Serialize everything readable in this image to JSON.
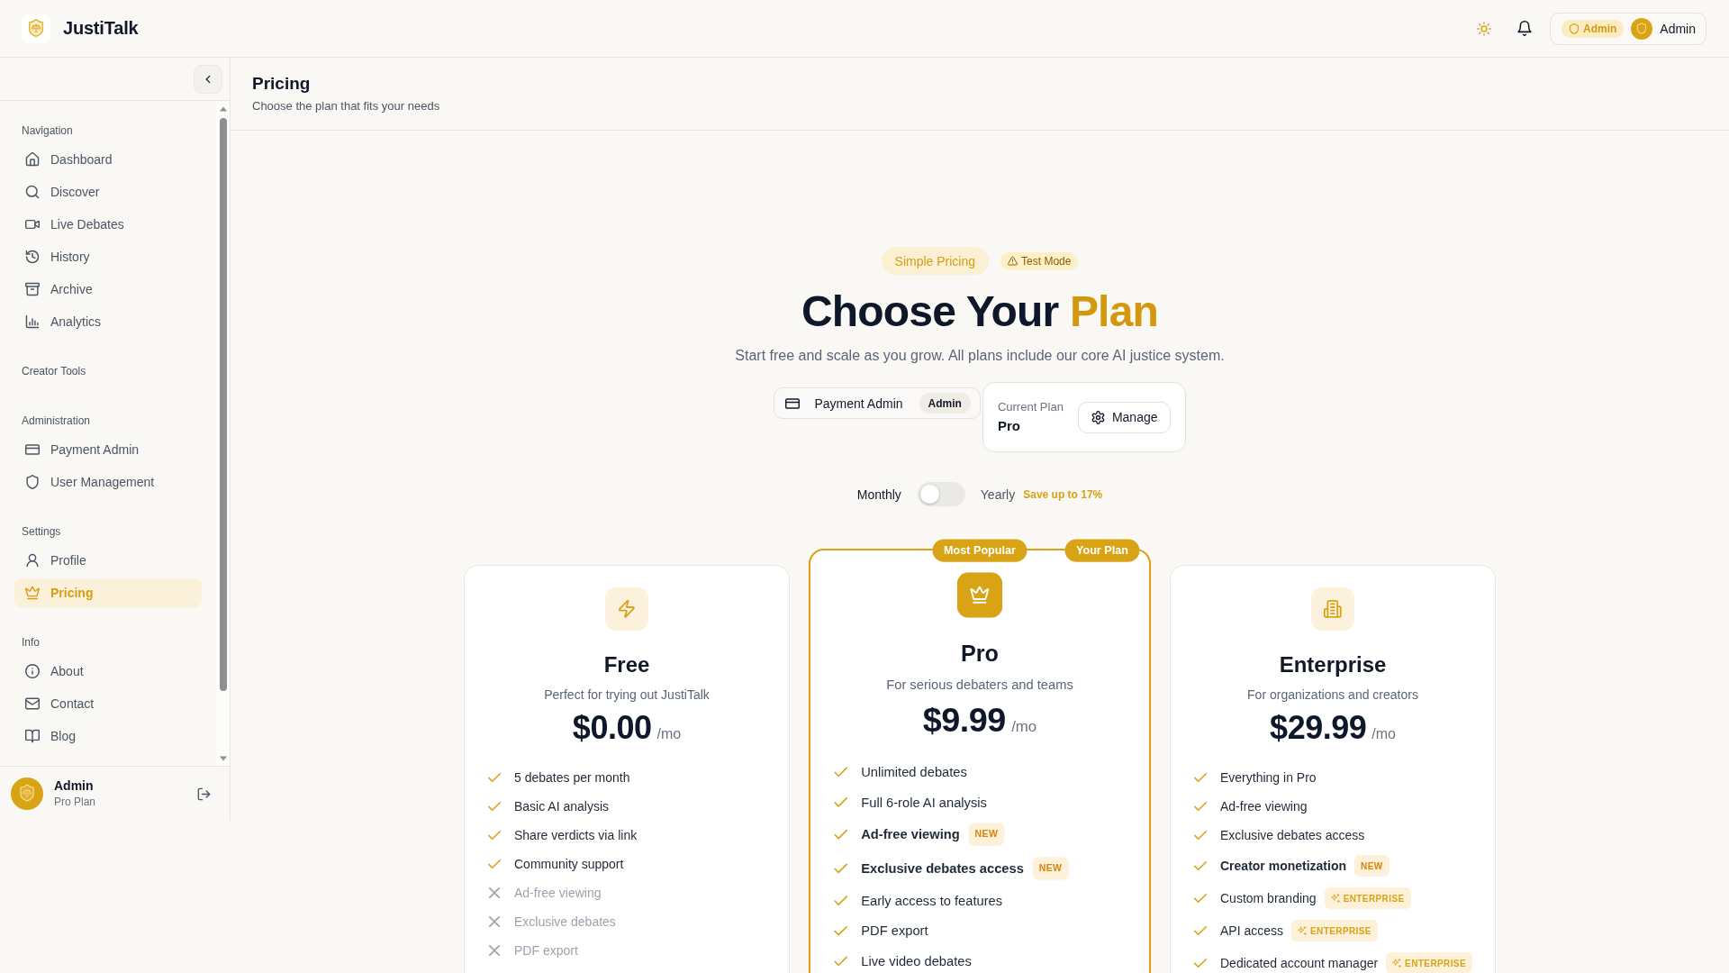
{
  "header": {
    "brand": "JustiTalk",
    "role_badge": "Admin",
    "user_name": "Admin"
  },
  "sidebar": {
    "sections": [
      {
        "title": "Navigation",
        "items": [
          {
            "label": "Dashboard",
            "selected": false
          },
          {
            "label": "Discover",
            "selected": false
          },
          {
            "label": "Live Debates",
            "selected": false
          },
          {
            "label": "History",
            "selected": false
          },
          {
            "label": "Archive",
            "selected": false
          },
          {
            "label": "Analytics",
            "selected": false
          }
        ]
      },
      {
        "title": "Creator Tools"
      },
      {
        "title": "Administration",
        "items": [
          {
            "label": "Payment Admin",
            "selected": false
          },
          {
            "label": "User Management",
            "selected": false
          }
        ]
      },
      {
        "title": "Settings",
        "items": [
          {
            "label": "Profile",
            "selected": false
          },
          {
            "label": "Pricing",
            "selected": true
          }
        ]
      },
      {
        "title": "Info",
        "items": [
          {
            "label": "About",
            "selected": false
          },
          {
            "label": "Contact",
            "selected": false
          },
          {
            "label": "Blog",
            "selected": false
          }
        ]
      }
    ],
    "user": {
      "name": "Admin",
      "plan": "Pro Plan"
    }
  },
  "page_header": {
    "title": "Pricing",
    "subtitle": "Choose the plan that fits your needs"
  },
  "hero": {
    "badges": [
      {
        "kind": "highlight",
        "label": "Simple Pricing"
      },
      {
        "kind": "warning",
        "label": "Test Mode"
      }
    ],
    "title": "Choose Your",
    "title_accent": "Plan",
    "subtitle": "Start free and scale as you grow. All plans include our core AI justice system."
  },
  "admin_link": {
    "label": "Payment Admin",
    "badge": "Admin"
  },
  "current_plan": {
    "label": "Current Plan",
    "value": "Pro",
    "button": "Manage"
  },
  "billing": {
    "options": [
      {
        "label": "Monthly",
        "selected": true
      },
      {
        "label": "Yearly",
        "selected": false
      }
    ],
    "savings": "Save up to 17%"
  },
  "plans": [
    {
      "name": "Free",
      "tagline": "Perfect for trying out JustiTalk",
      "price": "$0.00",
      "period": "/mo",
      "highlighted": false,
      "features": [
        {
          "label": "5 debates per month",
          "included": true
        },
        {
          "label": "Basic AI analysis",
          "included": true
        },
        {
          "label": "Share verdicts via link",
          "included": true
        },
        {
          "label": "Community support",
          "included": true
        },
        {
          "label": "Ad-free viewing",
          "included": false
        },
        {
          "label": "Exclusive debates",
          "included": false
        },
        {
          "label": "PDF export",
          "included": false
        }
      ]
    },
    {
      "name": "Pro",
      "tagline": "For serious debaters and teams",
      "price": "$9.99",
      "period": "/mo",
      "highlighted": true,
      "ribbons": [
        {
          "kind": "popular",
          "label": "Most Popular"
        },
        {
          "kind": "current",
          "label": "Your Plan"
        }
      ],
      "features": [
        {
          "label": "Unlimited debates",
          "included": true
        },
        {
          "label": "Full 6-role AI analysis",
          "included": true
        },
        {
          "label": "Ad-free viewing",
          "included": true,
          "badge": {
            "kind": "new",
            "label": "NEW"
          }
        },
        {
          "label": "Exclusive debates access",
          "included": true,
          "badge": {
            "kind": "new",
            "label": "NEW"
          }
        },
        {
          "label": "Early access to features",
          "included": true
        },
        {
          "label": "PDF export",
          "included": true
        },
        {
          "label": "Live video debates",
          "included": true
        }
      ]
    },
    {
      "name": "Enterprise",
      "tagline": "For organizations and creators",
      "price": "$29.99",
      "period": "/mo",
      "highlighted": false,
      "features": [
        {
          "label": "Everything in Pro",
          "included": true
        },
        {
          "label": "Ad-free viewing",
          "included": true
        },
        {
          "label": "Exclusive debates access",
          "included": true
        },
        {
          "label": "Creator monetization",
          "included": true,
          "badge": {
            "kind": "new",
            "label": "NEW"
          }
        },
        {
          "label": "Custom branding",
          "included": true,
          "badge": {
            "kind": "enterprise",
            "label": "ENTERPRISE"
          }
        },
        {
          "label": "API access",
          "included": true,
          "badge": {
            "kind": "enterprise",
            "label": "ENTERPRISE"
          }
        },
        {
          "label": "Dedicated account manager",
          "included": true,
          "badge": {
            "kind": "enterprise",
            "label": "ENTERPRISE"
          }
        }
      ]
    }
  ]
}
